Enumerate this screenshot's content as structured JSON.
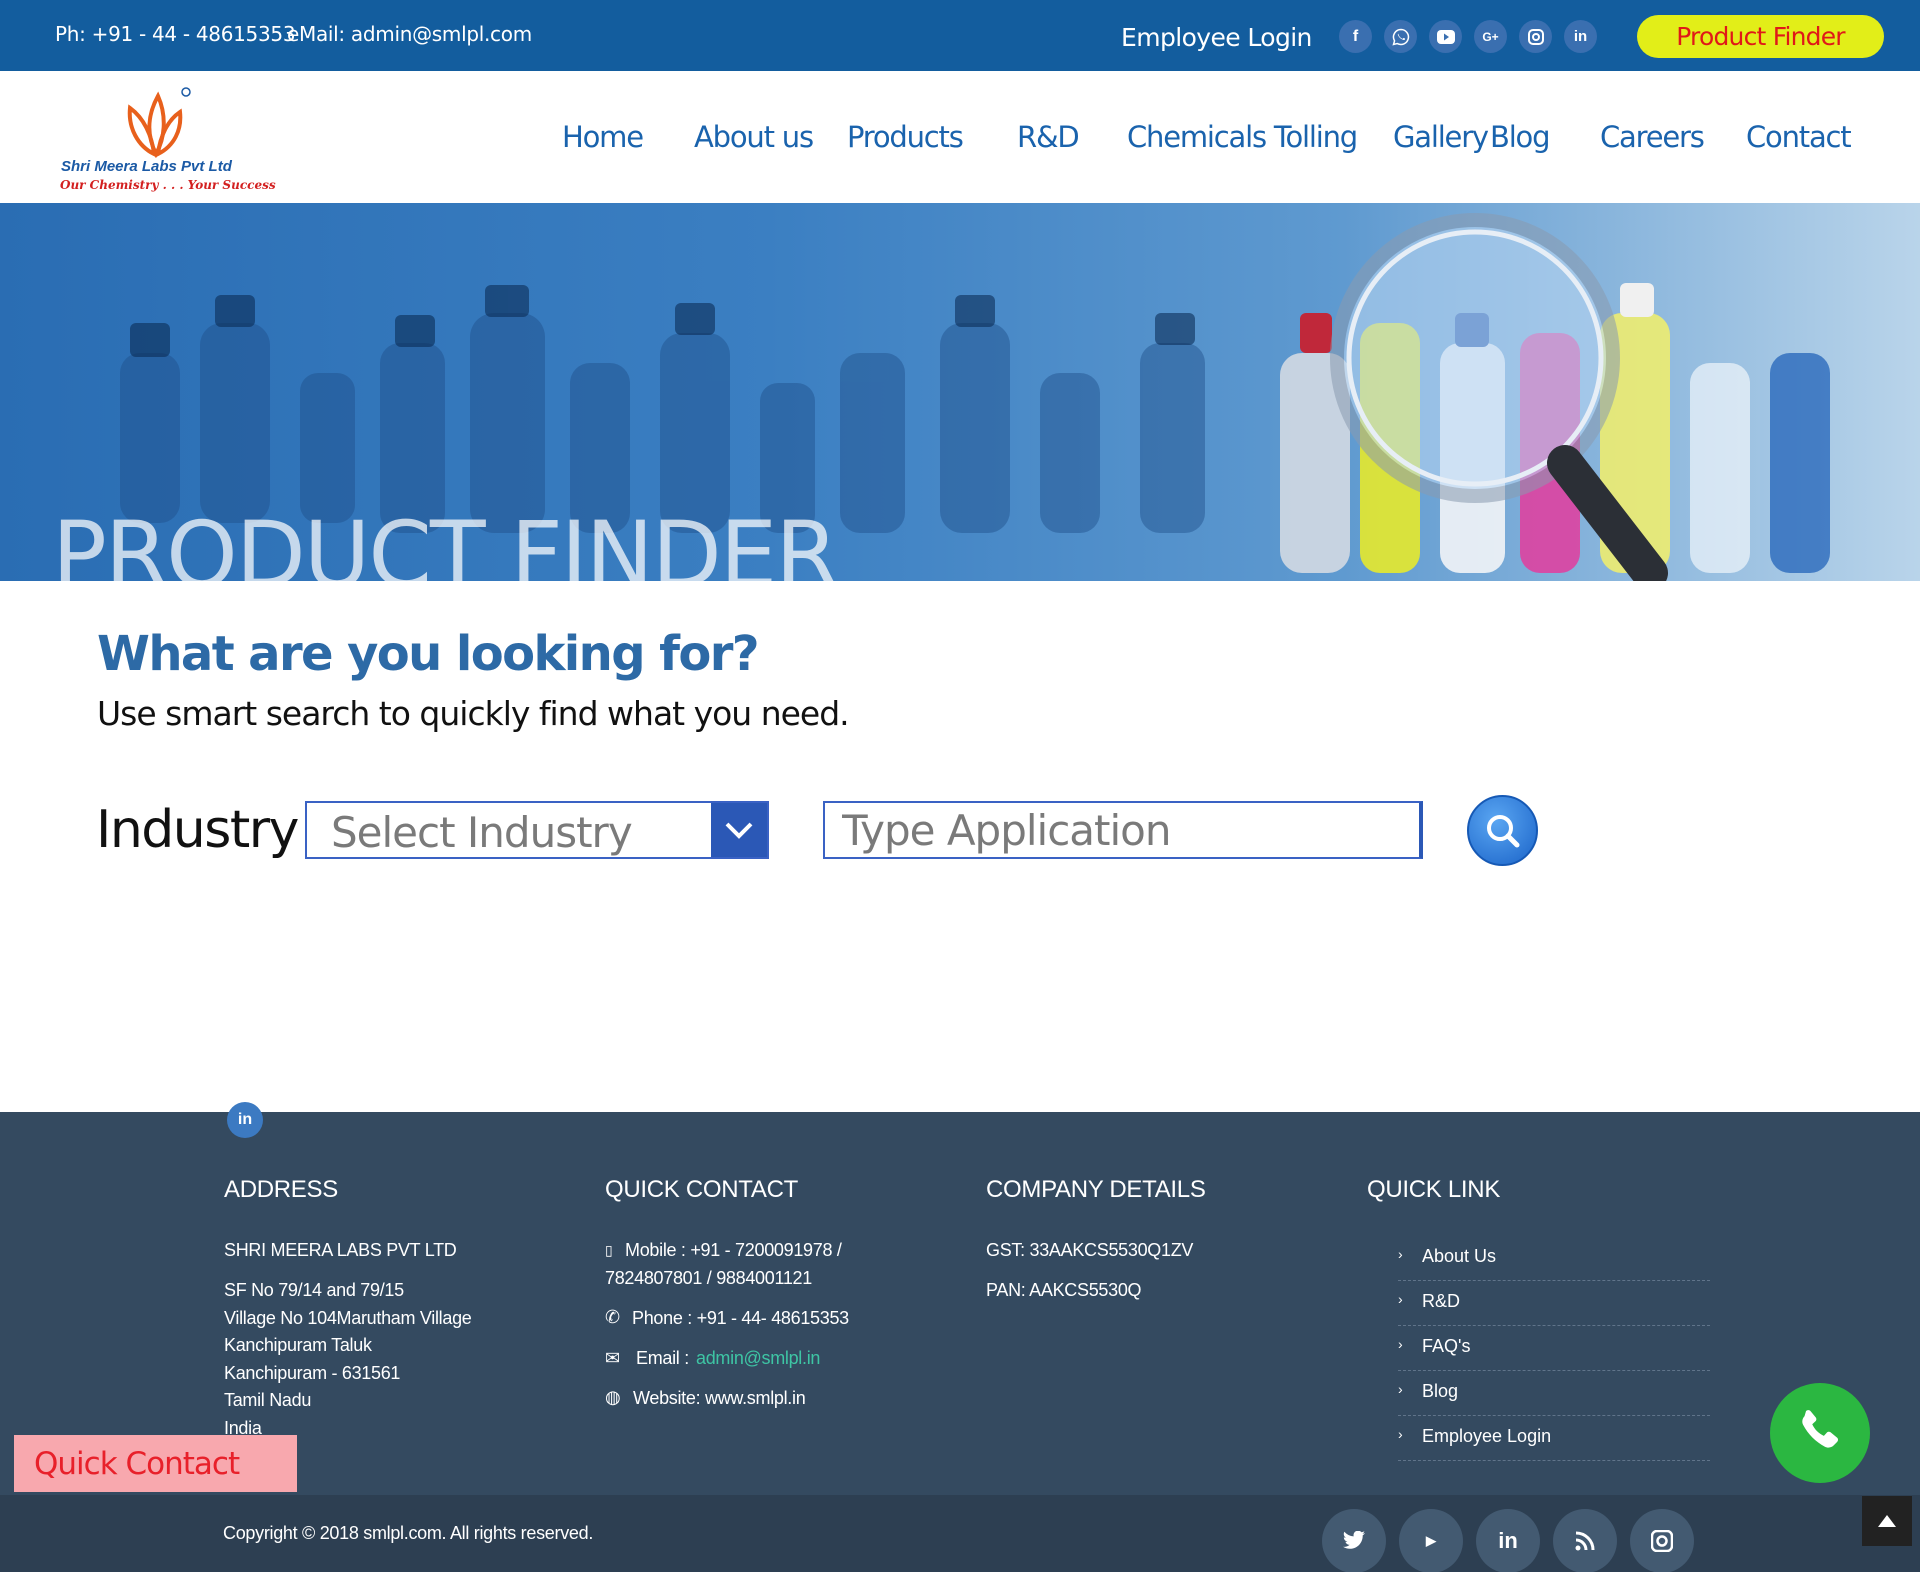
{
  "topbar": {
    "phone": "Ph: +91 - 44 - 48615353",
    "email": "eMail: admin@smlpl.com",
    "employee_login": "Employee Login",
    "product_finder": "Product Finder",
    "social_icons": [
      "facebook-icon",
      "whatsapp-icon",
      "youtube-icon",
      "google-plus-icon",
      "instagram-icon",
      "linkedin-icon"
    ]
  },
  "logo": {
    "brand": "Shri Meera Labs Pvt Ltd",
    "tagline": "Our Chemistry . . . Your Success"
  },
  "nav": [
    "Home",
    "About us",
    "Products",
    "R&D",
    "Chemicals Tolling",
    "Gallery",
    "Blog",
    "Careers",
    "Contact"
  ],
  "banner": {
    "title": "PRODUCT FINDER"
  },
  "finder": {
    "heading": "What are you looking for?",
    "subheading": "Use smart search to quickly find what you need.",
    "industry_label": "Industry",
    "industry_select": "Select Industry",
    "application_placeholder": "Type Application"
  },
  "footer": {
    "address": {
      "heading": "ADDRESS",
      "company": "SHRI MEERA LABS PVT LTD",
      "lines": [
        "SF No 79/14 and 79/15",
        "Village No 104Marutham Village",
        "Kanchipuram Taluk",
        "Kanchipuram - 631561",
        "Tamil Nadu",
        "India"
      ]
    },
    "quick_contact": {
      "heading": "QUICK CONTACT",
      "mobile_1": "Mobile : +91 - 7200091978 /",
      "mobile_2": "7824807801 / 9884001121",
      "phone": "Phone : +91 - 44- 48615353",
      "email_label": "Email : ",
      "email": "admin@smlpl.in",
      "website": "Website: www.smlpl.in"
    },
    "company": {
      "heading": "COMPANY DETAILS",
      "gst": "GST: 33AAKCS5530Q1ZV",
      "pan": "PAN: AAKCS5530Q"
    },
    "quick_link": {
      "heading": "QUICK LINK",
      "items": [
        "About Us",
        "R&D",
        "FAQ's",
        "Blog",
        "Employee Login"
      ]
    },
    "copyright": "Copyright © 2018 smlpl.com. All rights reserved.",
    "bottom_icons": [
      "twitter-icon",
      "youtube-icon",
      "linkedin-icon",
      "rss-icon",
      "instagram-icon"
    ]
  },
  "quick_contact_tab": "Quick Contact",
  "colors": {
    "topbar": "#135d9e",
    "nav_link": "#1a63ad",
    "product_finder_bg": "#e2ee18",
    "product_finder_text": "#e01818",
    "footer": "#344a60",
    "whatsapp": "#2bb741"
  }
}
